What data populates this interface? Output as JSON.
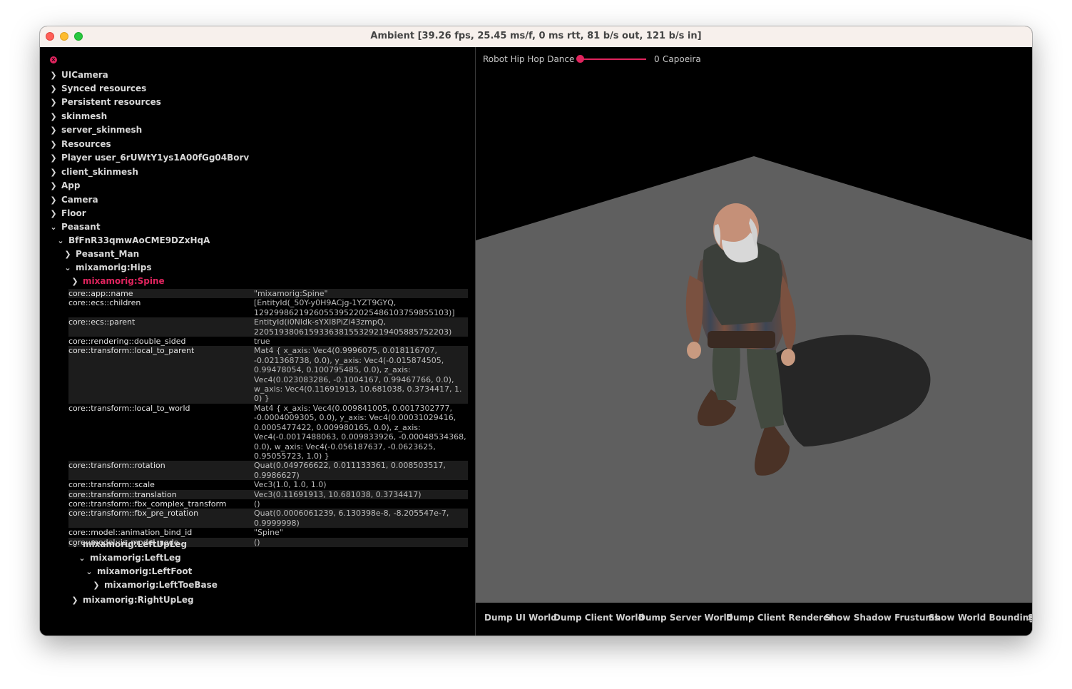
{
  "window": {
    "title": "Ambient [39.26 fps, 25.45 ms/f, 0 ms rtt, 81 b/s out, 121 b/s in]"
  },
  "tree": {
    "close_icon": "x-icon",
    "items": [
      {
        "label": "UICamera",
        "expanded": false
      },
      {
        "label": "Synced resources",
        "expanded": false
      },
      {
        "label": "Persistent resources",
        "expanded": false
      },
      {
        "label": "skinmesh",
        "expanded": false
      },
      {
        "label": "server_skinmesh",
        "expanded": false
      },
      {
        "label": "Resources",
        "expanded": false
      },
      {
        "label": "Player user_6rUWtY1ys1A00fGg04Borv",
        "expanded": false
      },
      {
        "label": "client_skinmesh",
        "expanded": false
      },
      {
        "label": "App",
        "expanded": false
      },
      {
        "label": "Camera",
        "expanded": false
      },
      {
        "label": "Floor",
        "expanded": false
      },
      {
        "label": "Peasant",
        "expanded": true
      },
      {
        "label": "BfFnR33qmwAoCME9DZxHqA",
        "expanded": true
      },
      {
        "label": "Peasant_Man",
        "expanded": false
      },
      {
        "label": "mixamorig:Hips",
        "expanded": true
      },
      {
        "label": "mixamorig:Spine",
        "expanded": false,
        "selected": true
      }
    ],
    "after_items": [
      {
        "label": "mixamorig:LeftUpLeg",
        "expanded": true
      },
      {
        "label": "mixamorig:LeftLeg",
        "expanded": true
      },
      {
        "label": "mixamorig:LeftFoot",
        "expanded": true
      },
      {
        "label": "mixamorig:LeftToeBase",
        "expanded": false
      },
      {
        "label": "mixamorig:RightUpLeg",
        "expanded": false
      }
    ]
  },
  "properties": [
    {
      "key": "core::app::name",
      "value": "\"mixamorig:Spine\""
    },
    {
      "key": "core::ecs::children",
      "value": "[EntityId(_50Y-y0H9ACjg-1YZT9GYQ,\n129299862192605539522025486103759855103)]"
    },
    {
      "key": "core::ecs::parent",
      "value": "EntityId(i0Nldk-sYXl8PiZi43zmpQ,\n220519380615933638155329219405885752203)"
    },
    {
      "key": "core::rendering::double_sided",
      "value": "true"
    },
    {
      "key": "core::transform::local_to_parent",
      "value": "Mat4 { x_axis: Vec4(0.9996075, 0.018116707,\n-0.021368738, 0.0), y_axis: Vec4(-0.015874505,\n0.99478054, 0.100795485, 0.0), z_axis:\nVec4(0.023083286, -0.1004167, 0.99467766, 0.0),\nw_axis: Vec4(0.11691913, 10.681038, 0.3734417, 1.0) }"
    },
    {
      "key": "core::transform::local_to_world",
      "value": "Mat4 { x_axis: Vec4(0.009841005, 0.0017302777,\n-0.0004009305, 0.0), y_axis: Vec4(0.00031029416,\n0.0005477422, 0.009980165, 0.0), z_axis:\nVec4(-0.0017488063, 0.009833926, -0.00048534368,\n0.0), w_axis: Vec4(-0.056187637, -0.0623625,\n0.95055723, 1.0) }"
    },
    {
      "key": "core::transform::rotation",
      "value": "Quat(0.049766622, 0.011133361, 0.008503517,\n0.9986627)"
    },
    {
      "key": "core::transform::scale",
      "value": "Vec3(1.0, 1.0, 1.0)"
    },
    {
      "key": "core::transform::translation",
      "value": "Vec3(0.11691913, 10.681038, 0.3734417)"
    },
    {
      "key": "core::transform::fbx_complex_transform",
      "value": "()"
    },
    {
      "key": "core::transform::fbx_pre_rotation",
      "value": "Quat(0.0006061239, 6.130398e-8, -8.205547e-7,\n0.9999998)"
    },
    {
      "key": "core::model::animation_bind_id",
      "value": "\"Spine\""
    },
    {
      "key": "core::model::is_model_node",
      "value": "()"
    }
  ],
  "animation": {
    "left_label": "Robot Hip Hop Dance",
    "slider_value": "0",
    "right_label": "Capoeira"
  },
  "bottom_buttons": [
    "Dump UI World",
    "Dump Client World",
    "Dump Server World",
    "Dump Client Renderer",
    "Show Shadow Frustums",
    "Show World Boundings",
    "S"
  ],
  "colors": {
    "accent": "#e0245e",
    "floor": "#5f5f5f",
    "background": "#000000"
  }
}
